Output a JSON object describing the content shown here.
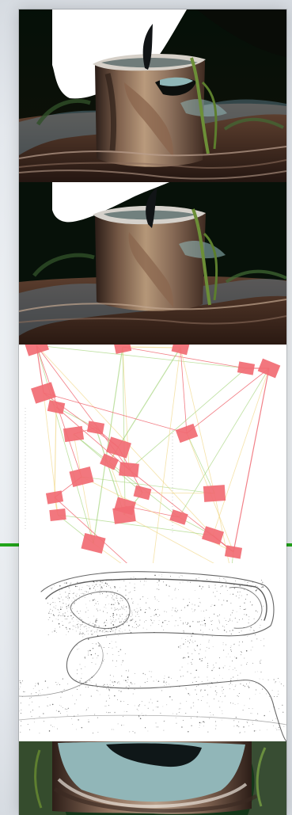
{
  "colors": {
    "page_background": "#e4e8ed",
    "camera_marker": "#f16b73",
    "line_red": "#f06c74",
    "line_green": "#9bd06d",
    "line_yellow": "#f0d37a",
    "green_separator": "#21a51a"
  },
  "visual_content": {
    "photos": [
      {
        "name": "stump-photo-top"
      },
      {
        "name": "stump-photo-middle"
      },
      {
        "name": "stump-photo-bottom"
      }
    ],
    "camera_pose_graph": {
      "name": "camera-pose-graph"
    },
    "point_cloud_render": {
      "name": "point-cloud-render"
    }
  }
}
